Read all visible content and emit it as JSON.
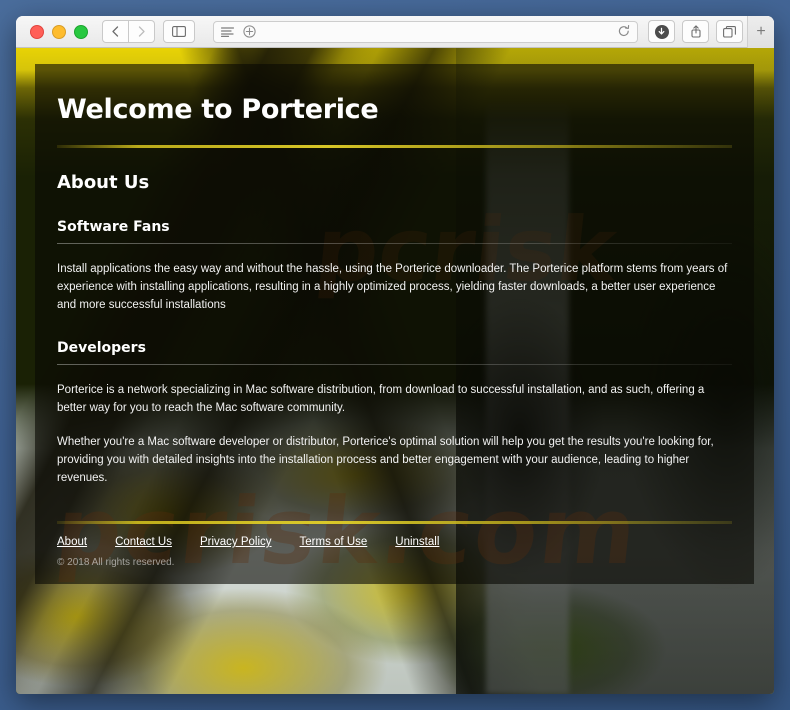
{
  "window": {
    "traffic_lights": [
      "close",
      "minimize",
      "zoom"
    ],
    "toolbar": {
      "back_label": "‹",
      "forward_label": "›",
      "sidebar_label": "sidebar",
      "address_value": "",
      "address_placeholder": "",
      "reader_label": "reader-view",
      "add_label": "+",
      "reload_label": "reload",
      "download_label": "downloads",
      "share_label": "share",
      "tabs_label": "show-tabs",
      "newtab_label": "+"
    }
  },
  "page": {
    "title": "Welcome to Porterice",
    "watermark": "pcrisk.com",
    "watermark_top": "pcrisk",
    "about_heading": "About Us",
    "sections": [
      {
        "heading": "Software Fans",
        "paragraphs": [
          "Install applications the easy way and without the hassle, using the Porterice downloader. The Porterice platform stems from years of experience with installing applications, resulting in a highly optimized process, yielding faster downloads, a better user experience and more successful installations"
        ]
      },
      {
        "heading": "Developers",
        "paragraphs": [
          "Porterice is a network specializing in Mac software distribution, from download to successful installation, and as such, offering a better way for you to reach the Mac software community.",
          "Whether you're a Mac software developer or distributor, Porterice's optimal solution will help you get the results you're looking for, providing you with detailed insights into the installation process and better engagement with your audience, leading to higher revenues."
        ]
      }
    ],
    "footer": {
      "links": [
        {
          "label": "About"
        },
        {
          "label": "Contact Us"
        },
        {
          "label": "Privacy Policy"
        },
        {
          "label": "Terms of Use"
        },
        {
          "label": "Uninstall"
        }
      ],
      "copyright": "© 2018 All rights reserved."
    }
  },
  "colors": {
    "desktop": "#41648f",
    "accent_rule": "#e2d028",
    "panel_overlay": "rgba(8,9,4,.60)",
    "text": "#ffffff",
    "watermark": "#d66018"
  }
}
